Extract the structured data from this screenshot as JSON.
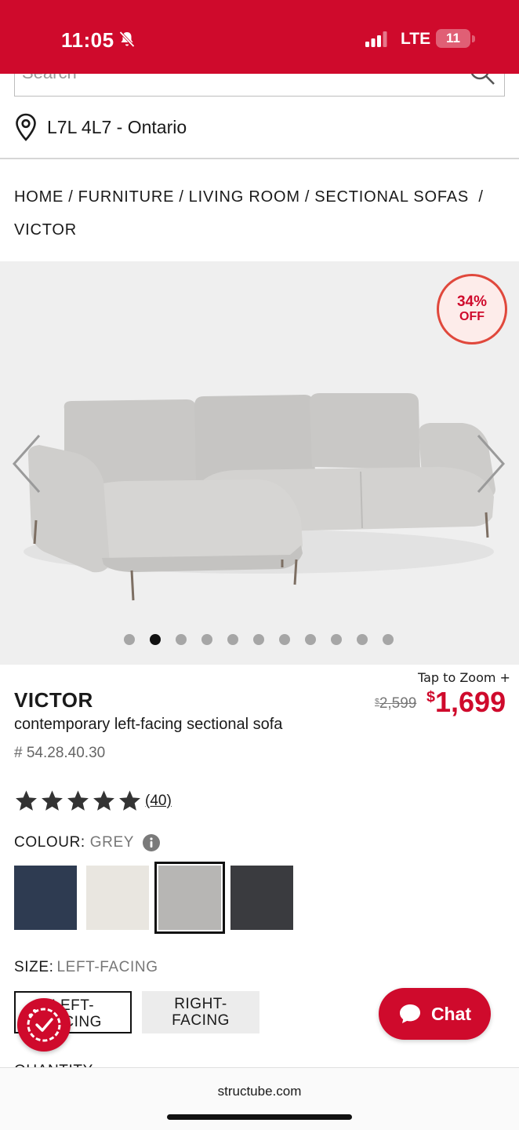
{
  "status_bar": {
    "time": "11:05",
    "network": "LTE",
    "battery": "11",
    "battery_level_percent": 11
  },
  "search": {
    "placeholder": "Search"
  },
  "location": {
    "text": "L7L 4L7 - Ontario"
  },
  "breadcrumb": [
    "HOME",
    "FURNITURE",
    "LIVING ROOM",
    "SECTIONAL SOFAS",
    "VICTOR"
  ],
  "gallery": {
    "badge_pct": "34%",
    "badge_off": "OFF",
    "image_count": 11,
    "active_index": 1
  },
  "product": {
    "tap_to_zoom": "Tap to Zoom  +",
    "name": "VICTOR",
    "description": "contemporary left-facing sectional sofa",
    "sku": "# 54.28.40.30",
    "price_old_symbol": "$",
    "price_old": "2,599",
    "price_new_symbol": "$",
    "price_new": "1,699",
    "rating_stars": 5,
    "review_count": "(40)"
  },
  "colour": {
    "label": "COLOUR:",
    "value": "GREY",
    "swatches": [
      {
        "name": "navy",
        "color": "#2e3b51"
      },
      {
        "name": "cream",
        "color": "#e9e6e0"
      },
      {
        "name": "grey",
        "color": "#b7b6b4",
        "selected": true
      },
      {
        "name": "charcoal",
        "color": "#3a3b3f"
      }
    ]
  },
  "size": {
    "label": "SIZE:",
    "value": "LEFT-FACING",
    "options": [
      {
        "line1": "LEFT-",
        "line2": "FACING",
        "selected": true
      },
      {
        "line1": "RIGHT-",
        "line2": "FACING",
        "selected": false
      }
    ]
  },
  "quantity": {
    "label": "QUANTITY"
  },
  "chat": {
    "label": "Chat"
  },
  "browser": {
    "domain": "structube.com"
  },
  "colors": {
    "brand_red": "#cf0a2c"
  }
}
